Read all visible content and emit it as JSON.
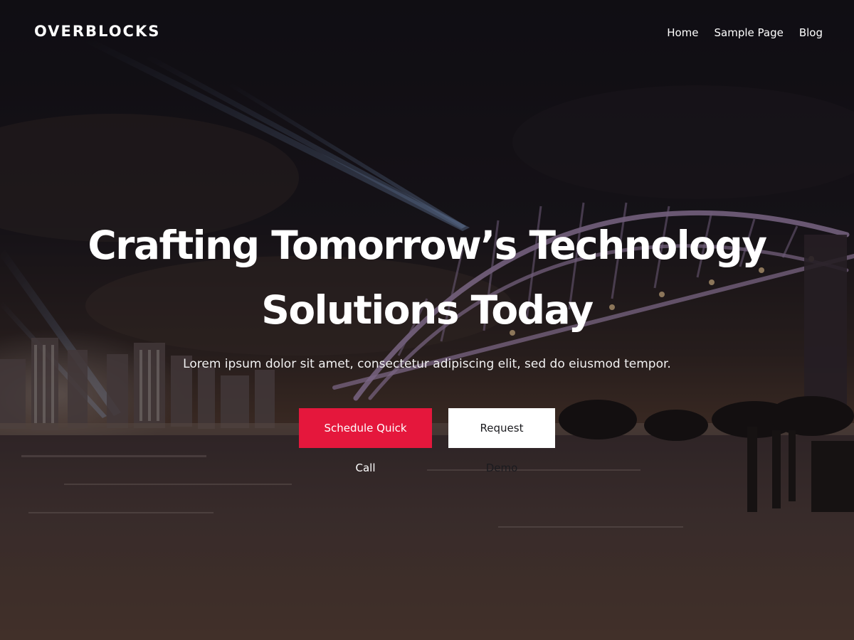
{
  "site": {
    "logo": "OVERBLOCKS"
  },
  "nav": {
    "items": [
      {
        "label": "Home"
      },
      {
        "label": "Sample Page"
      },
      {
        "label": "Blog"
      }
    ]
  },
  "hero": {
    "title_line1": "Crafting Tomorrow’s Technology",
    "title_line2": "Solutions Today",
    "subtitle": "Lorem ipsum dolor sit amet, consectetur adipiscing elit, sed do eiusmod tempor.",
    "primary_button": "Schedule Quick Call",
    "secondary_button": "Request Demo"
  },
  "colors": {
    "accent": "#e5173c",
    "secondary_button_bg": "#ffffff",
    "text": "#ffffff"
  }
}
